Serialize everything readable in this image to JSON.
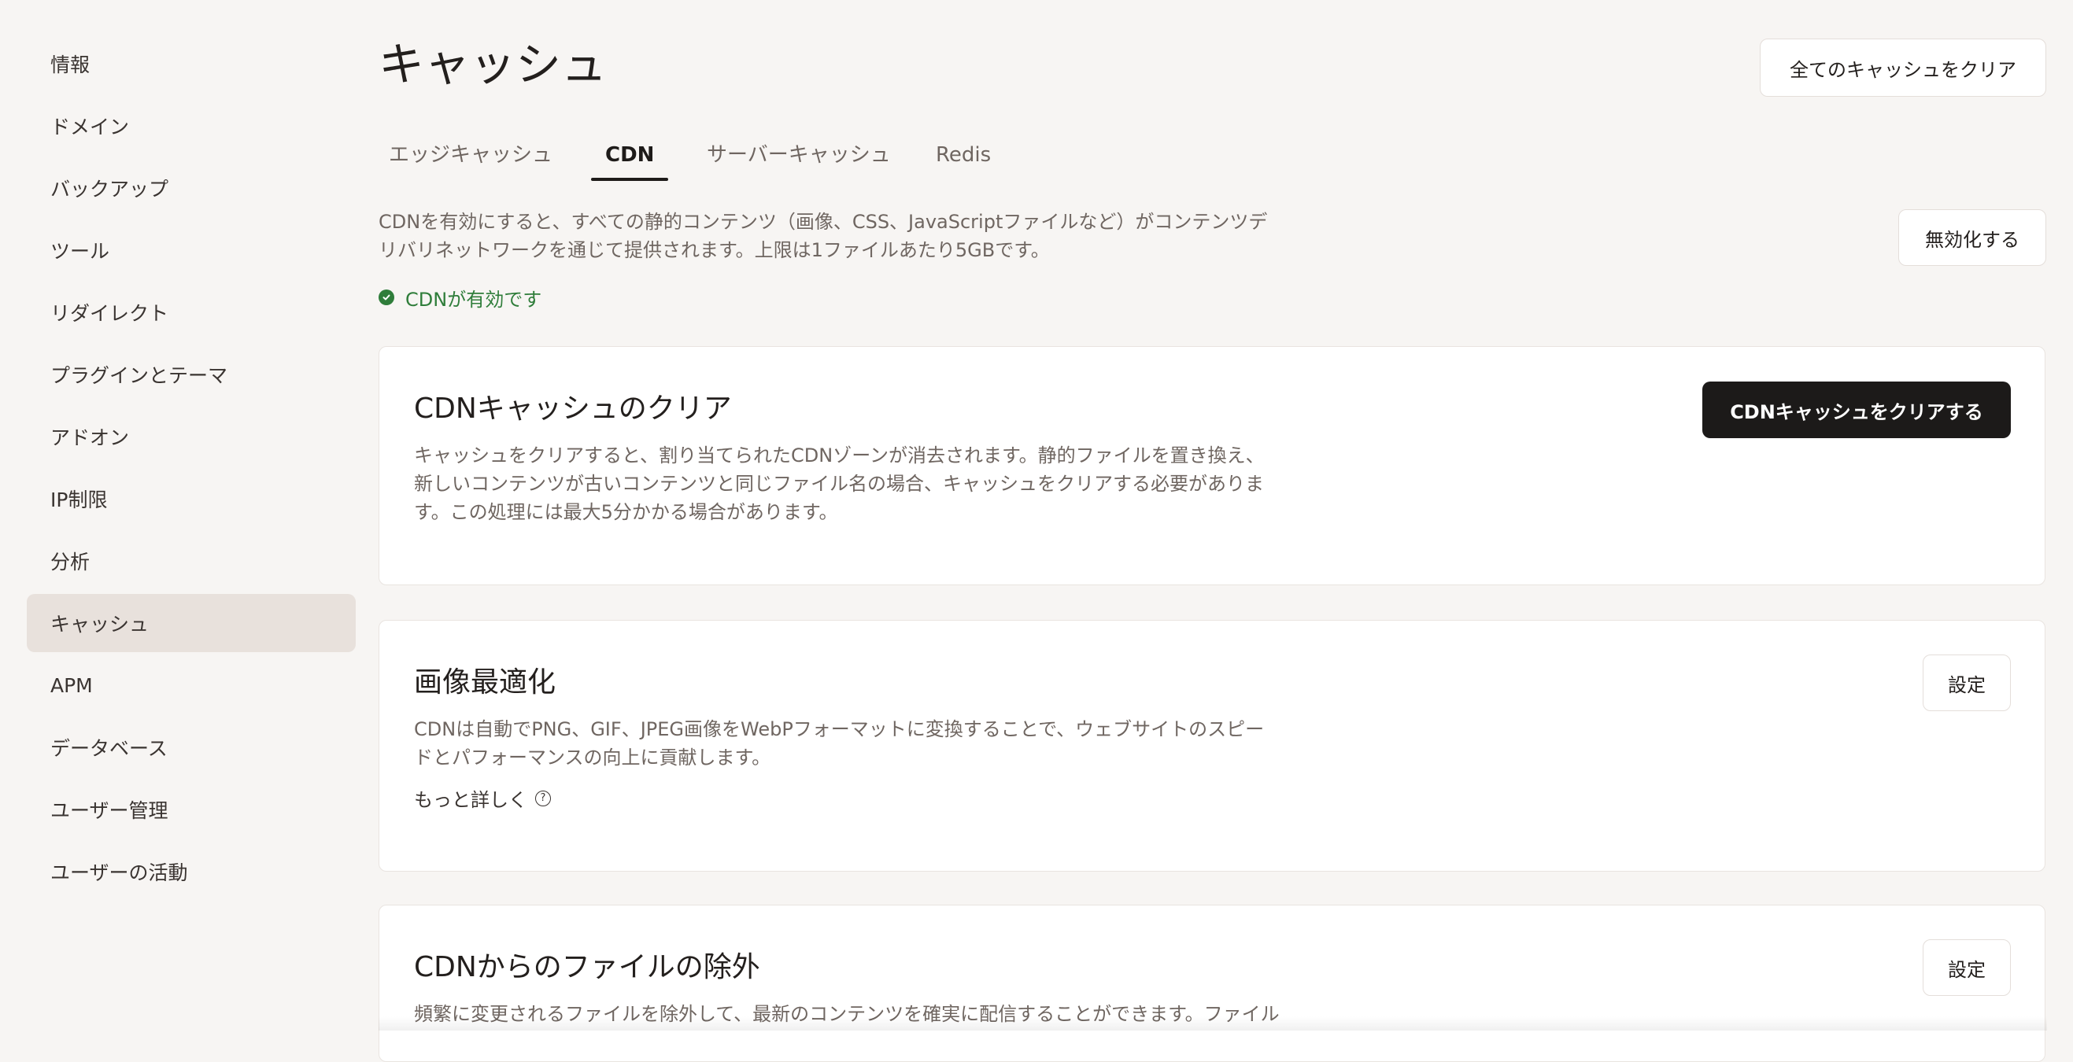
{
  "sidebar": {
    "items": [
      {
        "label": "情報"
      },
      {
        "label": "ドメイン"
      },
      {
        "label": "バックアップ"
      },
      {
        "label": "ツール"
      },
      {
        "label": "リダイレクト"
      },
      {
        "label": "プラグインとテーマ"
      },
      {
        "label": "アドオン"
      },
      {
        "label": "IP制限"
      },
      {
        "label": "分析"
      },
      {
        "label": "キャッシュ",
        "active": true
      },
      {
        "label": "APM"
      },
      {
        "label": "データベース"
      },
      {
        "label": "ユーザー管理"
      },
      {
        "label": "ユーザーの活動"
      }
    ]
  },
  "header": {
    "title": "キャッシュ",
    "clear_all_label": "全てのキャッシュをクリア"
  },
  "tabs": [
    {
      "label": "エッジキャッシュ"
    },
    {
      "label": "CDN",
      "active": true
    },
    {
      "label": "サーバーキャッシュ"
    },
    {
      "label": "Redis"
    }
  ],
  "cdn": {
    "description_line1": "CDNを有効にすると、すべての静的コンテンツ（画像、CSS、JavaScriptファイルなど）がコンテンツデ",
    "description_line2": "リバリネットワークを通じて提供されます。上限は1ファイルあたり5GBです。",
    "disable_label": "無効化する",
    "status_text": "CDNが有効です",
    "status_color": "#2f7d3a"
  },
  "cards": {
    "clear_cache": {
      "title": "CDNキャッシュのクリア",
      "text_line1": "キャッシュをクリアすると、割り当てられたCDNゾーンが消去されます。静的ファイルを置き換え、",
      "text_line2": "新しいコンテンツが古いコンテンツと同じファイル名の場合、キャッシュをクリアする必要がありま",
      "text_line3": "す。この処理には最大5分かかる場合があります。",
      "button_label": "CDNキャッシュをクリアする"
    },
    "image_optimization": {
      "title": "画像最適化",
      "text_line1": "CDNは自動でPNG、GIF、JPEG画像をWebPフォーマットに変換することで、ウェブサイトのスピー",
      "text_line2": "ドとパフォーマンスの向上に貢献します。",
      "learn_more_label": "もっと詳しく",
      "button_label": "設定"
    },
    "exclusion": {
      "title": "CDNからのファイルの除外",
      "text_line1": "頻繁に変更されるファイルを除外して、最新のコンテンツを確実に配信することができます。ファイル",
      "button_label": "設定"
    }
  }
}
